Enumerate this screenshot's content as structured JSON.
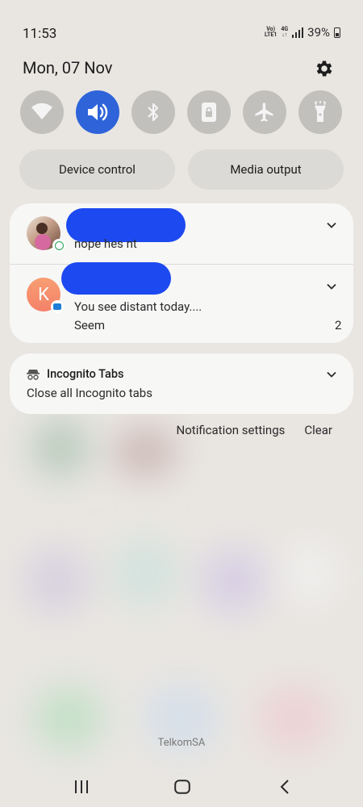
{
  "status": {
    "time": "11:53",
    "volte_top": "Vo)",
    "volte_bottom": "LTE1",
    "network": "4G",
    "battery": "39%"
  },
  "header": {
    "date": "Mon, 07 Nov"
  },
  "quick_settings": {
    "tiles": [
      {
        "icon": "wifi-icon",
        "active": false
      },
      {
        "icon": "sound-icon",
        "active": true
      },
      {
        "icon": "bluetooth-icon",
        "active": false
      },
      {
        "icon": "portrait-lock-icon",
        "active": false
      },
      {
        "icon": "airplane-icon",
        "active": false
      },
      {
        "icon": "flashlight-icon",
        "active": false
      }
    ],
    "device_control": "Device control",
    "media_output": "Media output"
  },
  "notifications": {
    "whatsapp": {
      "message": "nope hes nt"
    },
    "messages": {
      "initial": "K",
      "line1": "You see distant today....",
      "line2": "Seem",
      "count": "2"
    },
    "incognito": {
      "title": "Incognito Tabs",
      "body": "Close all Incognito tabs"
    }
  },
  "actions": {
    "settings": "Notification settings",
    "clear": "Clear"
  },
  "footer": {
    "carrier": "TelkomSA"
  },
  "colors": {
    "accent": "#2e63d9",
    "redaction": "#1d49f0",
    "message_avatar": "#f58a6a"
  }
}
